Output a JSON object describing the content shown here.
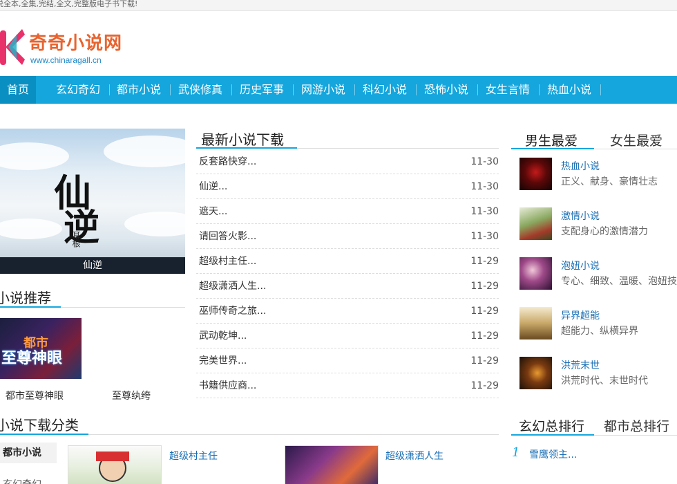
{
  "topbar": {
    "text": "说全本,全集,完结,全文,完整版电子书下载!"
  },
  "logo": {
    "name": "奇奇小说网",
    "url": "www.chinaragall.cn"
  },
  "nav": {
    "items": [
      "首页",
      "玄幻奇幻",
      "都市小说",
      "武侠修真",
      "历史军事",
      "网游小说",
      "科幻小说",
      "恐怖小说",
      "女生言情",
      "热血小说"
    ]
  },
  "featured": {
    "cover_title_1": "仙",
    "cover_title_2": "逆",
    "cover_author": "耳根",
    "caption": "仙逆"
  },
  "recommend": {
    "title": "小说推荐",
    "book_cover_line1": "都市",
    "book_cover_line2": "至尊神眼",
    "books": [
      "都市至尊神眼",
      "至尊纨绔"
    ]
  },
  "latest": {
    "title": "最新小说下载",
    "items": [
      {
        "title": "反套路快穿...",
        "date": "11-30"
      },
      {
        "title": "仙逆...",
        "date": "11-30"
      },
      {
        "title": "遮天...",
        "date": "11-30"
      },
      {
        "title": "请回答火影...",
        "date": "11-30"
      },
      {
        "title": "超级村主任...",
        "date": "11-29"
      },
      {
        "title": "超级潇洒人生...",
        "date": "11-29"
      },
      {
        "title": "巫师传奇之旅...",
        "date": "11-29"
      },
      {
        "title": "武动乾坤...",
        "date": "11-29"
      },
      {
        "title": "完美世界...",
        "date": "11-29"
      },
      {
        "title": "书籍供应商...",
        "date": "11-29"
      }
    ]
  },
  "favorites": {
    "tabs": [
      "男生最爱",
      "女生最爱"
    ],
    "items": [
      {
        "name": "热血小说",
        "desc": "正义、献身、豪情壮志",
        "thumb_color": "#8b1010"
      },
      {
        "name": "激情小说",
        "desc": "支配身心的激情潜力",
        "thumb_color": "#6a8a3a"
      },
      {
        "name": "泡妞小说",
        "desc": "专心、细致、温暖、泡妞技",
        "thumb_color": "#7a3a6a"
      },
      {
        "name": "异界超能",
        "desc": "超能力、纵横异界",
        "thumb_color": "#b08a40"
      },
      {
        "name": "洪荒末世",
        "desc": "洪荒时代、末世时代",
        "thumb_color": "#3a2a1a"
      }
    ]
  },
  "downloads": {
    "title": "小说下载分类",
    "sidebar": [
      "都市小说",
      "玄幻奇幻"
    ],
    "books": [
      "超级村主任",
      "超级潇洒人生"
    ]
  },
  "ranking": {
    "tabs": [
      "玄幻总排行",
      "都市总排行"
    ],
    "items": [
      {
        "num": "1",
        "title": "雪鹰领主..."
      }
    ]
  },
  "colors": {
    "accent": "#14a6dd",
    "nav_active": "#0a8fc2",
    "link": "#1a6fb5",
    "logo": "#e8632f"
  }
}
